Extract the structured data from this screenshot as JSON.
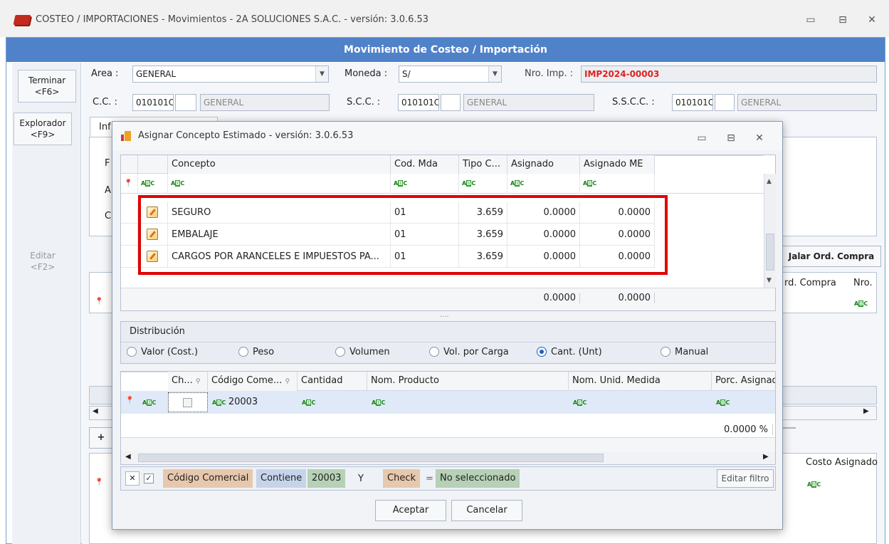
{
  "window": {
    "title": "COSTEO / IMPORTACIONES - Movimientos - 2A SOLUCIONES S.A.C. - versión: 3.0.6.53",
    "header": "Movimiento de Costeo / Importación"
  },
  "sidebar": {
    "terminar": "Terminar",
    "terminar_key": "<F6>",
    "explorador": "Explorador",
    "explorador_key": "<F9>",
    "editar": "Editar",
    "editar_key": "<F2>"
  },
  "form": {
    "area_label": "Area :",
    "area_value": "GENERAL",
    "moneda_label": "Moneda :",
    "moneda_value": "S/",
    "nro_imp_label": "Nro. Imp. :",
    "nro_imp_value": "IMP2024-00003",
    "cc_label": "C.C. :",
    "cc_code": "010101C",
    "cc_name": "GENERAL",
    "scc_label": "S.C.C. :",
    "scc_code": "010101C",
    "scc_name": "GENERAL",
    "sscc_label": "S.S.C.C. :",
    "sscc_code": "010101C",
    "sscc_name": "GENERAL",
    "tab_partial": "Inf",
    "letters": [
      "F",
      "A",
      "C"
    ],
    "jalar_btn": "Jalar Ord. Compra",
    "ord_compra_col": "rd. Compra",
    "nro_col": "Nro.",
    "costo_asignado_col": "Costo Asignado",
    "plus": "+"
  },
  "dialog": {
    "title": "Asignar Concepto Estimado - versión: 3.0.6.53",
    "columns": [
      "Concepto",
      "Cod. Mda",
      "Tipo C...",
      "Asignado",
      "Asignado ME"
    ],
    "rows": [
      {
        "concepto": "SEGURO",
        "cod_mda": "01",
        "tipo_c": "3.659",
        "asignado": "0.0000",
        "asignado_me": "0.0000"
      },
      {
        "concepto": "EMBALAJE",
        "cod_mda": "01",
        "tipo_c": "3.659",
        "asignado": "0.0000",
        "asignado_me": "0.0000"
      },
      {
        "concepto": "CARGOS POR ARANCELES E IMPUESTOS PA...",
        "cod_mda": "01",
        "tipo_c": "3.659",
        "asignado": "0.0000",
        "asignado_me": "0.0000"
      }
    ],
    "total_asignado": "0.0000",
    "total_asignado_me": "0.0000",
    "splitter": "....",
    "distribucion_label": "Distribución",
    "radios": [
      {
        "label": "Valor (Cost.)",
        "selected": false
      },
      {
        "label": "Peso",
        "selected": false
      },
      {
        "label": "Volumen",
        "selected": false
      },
      {
        "label": "Vol. por Carga",
        "selected": false
      },
      {
        "label": "Cant. (Unt)",
        "selected": true
      },
      {
        "label": "Manual",
        "selected": false
      }
    ],
    "grid2_columns": [
      "Ch...",
      "Código Come...",
      "Cantidad",
      "Nom. Producto",
      "Nom. Unid. Medida",
      "Porc. Asignad"
    ],
    "filter_code_value": "20003",
    "porc_total": "0.0000 %",
    "filter": {
      "field1": "Código Comercial",
      "op1": "Contiene",
      "val1": "20003",
      "joiner": "Y",
      "field2": "Check",
      "op2": "=",
      "val2": "No seleccionado",
      "edit_btn": "Editar filtro"
    },
    "ok_btn": "Aceptar",
    "cancel_btn": "Cancelar"
  }
}
